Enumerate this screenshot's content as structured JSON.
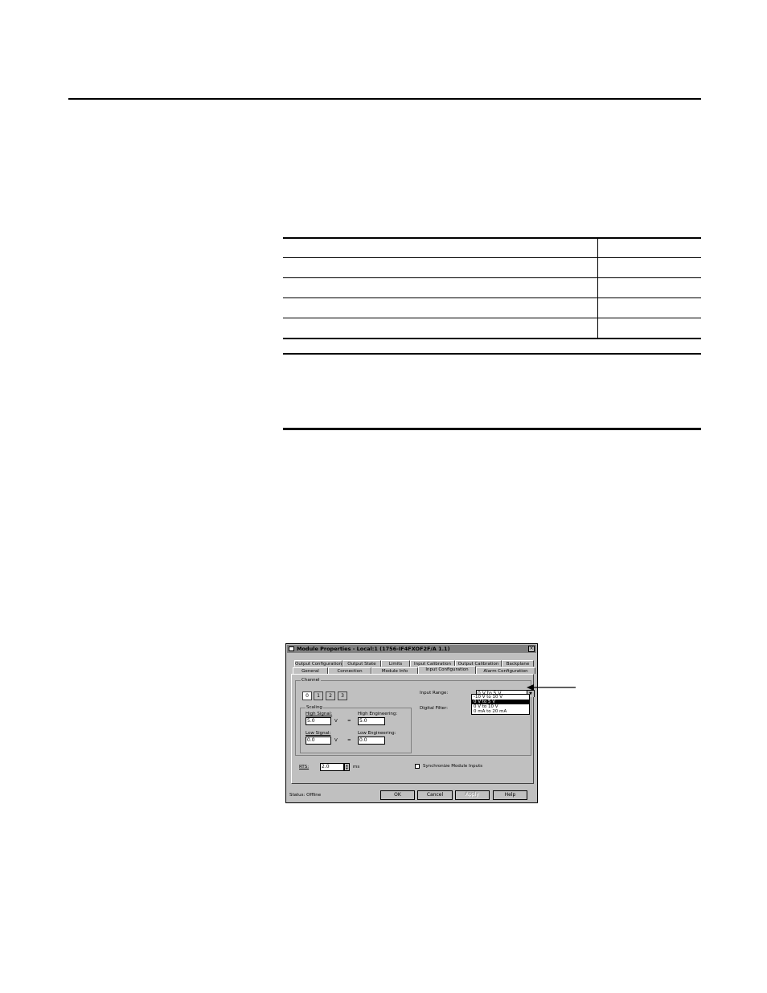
{
  "dialog": {
    "title": "Module Properties - Local:1 (1756-IF4FXOF2F/A 1.1)",
    "close": "×",
    "tabs_row1": [
      "Output Configuration",
      "Output State",
      "Limits",
      "Input Calibration",
      "Output Calibration",
      "Backplane"
    ],
    "tabs_row2": [
      "General",
      "Connection",
      "Module Info",
      "Input Configuration",
      "Alarm Configuration"
    ],
    "channel_label": "Channel",
    "channels": [
      "0",
      "1",
      "2",
      "3"
    ],
    "scaling_label": "Scaling",
    "high_signal_label": "High Signal:",
    "high_signal_value": "5.0",
    "low_signal_label": "Low Signal:",
    "low_signal_value": "0.0",
    "unit_v": "V",
    "equals": "=",
    "high_eng_label": "High Engineering:",
    "high_eng_value": "5.0",
    "low_eng_label": "Low Engineering:",
    "low_eng_value": "0.0",
    "input_range_label": "Input Range:",
    "input_range_value": "0 V to 5 V",
    "input_range_options": [
      "-10 V to 10 V",
      "0 V to 5 V",
      "0 V to 10 V",
      "0 mA to 20 mA"
    ],
    "digital_filter_label": "Digital Filter:",
    "rts_label": "RTS:",
    "rts_value": "2.0",
    "rts_unit": "ms",
    "sync_label": "Synchronize Module Inputs",
    "status_text": "Status:  Offline",
    "buttons": {
      "ok": "OK",
      "cancel": "Cancel",
      "apply": "Apply",
      "help": "Help"
    }
  }
}
